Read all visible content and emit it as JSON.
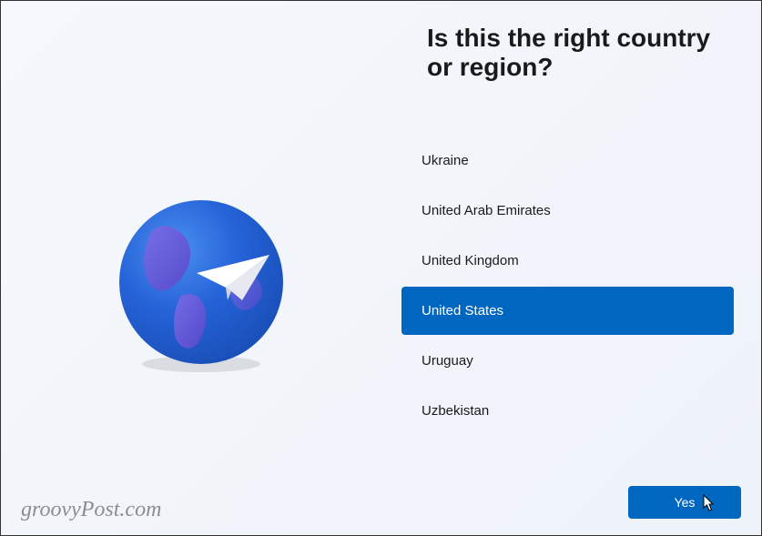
{
  "heading": "Is this the right country or region?",
  "countries": [
    {
      "name": "Ukraine",
      "selected": false
    },
    {
      "name": "United Arab Emirates",
      "selected": false
    },
    {
      "name": "United Kingdom",
      "selected": false
    },
    {
      "name": "United States",
      "selected": true
    },
    {
      "name": "Uruguay",
      "selected": false
    },
    {
      "name": "Uzbekistan",
      "selected": false
    }
  ],
  "confirm_button": "Yes",
  "watermark": "groovyPost.com",
  "colors": {
    "accent": "#0067c0",
    "text": "#1a1a1a"
  }
}
